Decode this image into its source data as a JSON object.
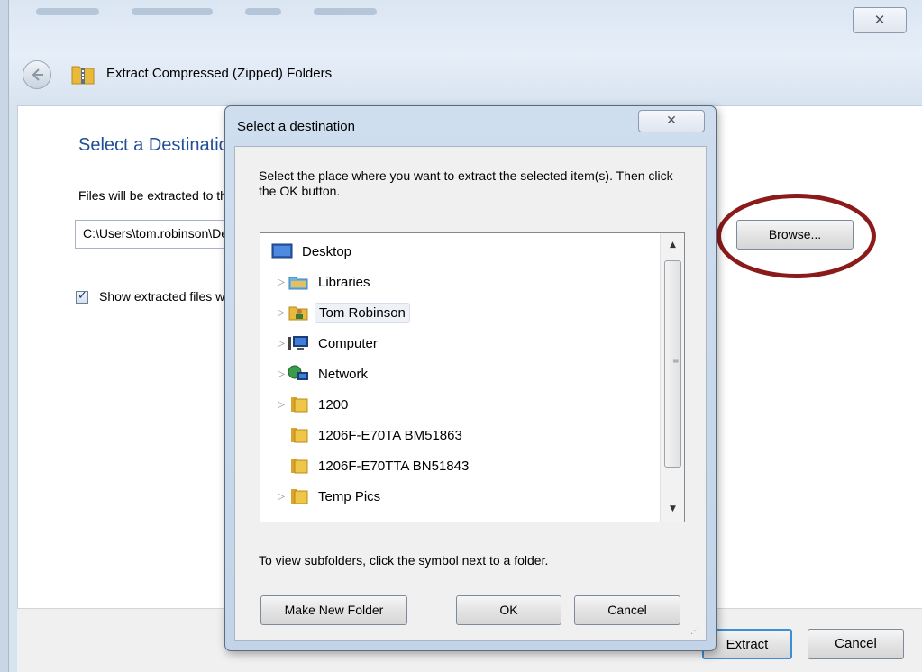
{
  "wizard": {
    "title": "Extract Compressed (Zipped) Folders",
    "close_glyph": "✕",
    "heading": "Select a Destination and Extract Files",
    "files_label": "Files will be extracted to this folder:",
    "path_value": "C:\\Users\\tom.robinson\\Desktop\\Archive",
    "browse_label": "Browse...",
    "show_files_label": "Show extracted files when complete",
    "show_files_checked": true,
    "extract_label": "Extract",
    "cancel_label": "Cancel"
  },
  "dialog": {
    "title": "Select a destination",
    "close_glyph": "✕",
    "instructions": "Select the place where you want to extract the selected item(s).  Then click the OK button.",
    "tree": [
      {
        "label": "Desktop",
        "icon": "desktop-icon",
        "expandable": false,
        "level": 0
      },
      {
        "label": "Libraries",
        "icon": "libraries-icon",
        "expandable": true,
        "level": 1
      },
      {
        "label": "Tom Robinson",
        "icon": "user-folder-icon",
        "expandable": true,
        "level": 1,
        "selected": true
      },
      {
        "label": "Computer",
        "icon": "computer-icon",
        "expandable": true,
        "level": 1
      },
      {
        "label": "Network",
        "icon": "network-icon",
        "expandable": true,
        "level": 1
      },
      {
        "label": "1200",
        "icon": "folder-icon",
        "expandable": true,
        "level": 1
      },
      {
        "label": "1206F-E70TA BM51863",
        "icon": "folder-icon",
        "expandable": false,
        "level": 1
      },
      {
        "label": "1206F-E70TTA BN51843",
        "icon": "folder-icon",
        "expandable": false,
        "level": 1
      },
      {
        "label": "Temp Pics",
        "icon": "folder-icon",
        "expandable": true,
        "level": 1
      }
    ],
    "hint": "To view subfolders, click the symbol next to a folder.",
    "make_new_folder_label": "Make New Folder",
    "ok_label": "OK",
    "cancel_label": "Cancel"
  },
  "colors": {
    "heading_blue": "#1e4e96",
    "highlight_ellipse": "#8b1a1a",
    "default_button_border": "#3c8fd4"
  }
}
